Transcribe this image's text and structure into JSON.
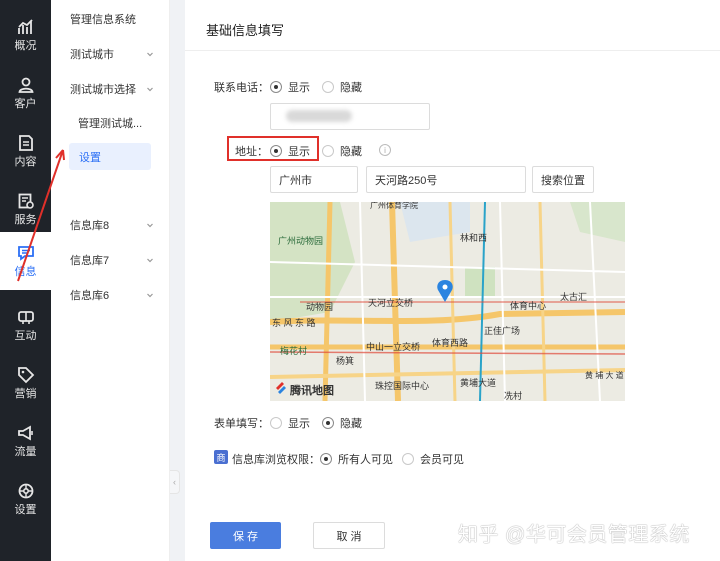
{
  "rail": {
    "items": [
      {
        "label": "概况",
        "icon": "bar-chart-icon"
      },
      {
        "label": "客户",
        "icon": "user-icon"
      },
      {
        "label": "内容",
        "icon": "document-icon"
      },
      {
        "label": "服务",
        "icon": "service-icon"
      },
      {
        "label": "信息",
        "icon": "message-icon"
      },
      {
        "label": "互动",
        "icon": "interaction-icon"
      },
      {
        "label": "营销",
        "icon": "tag-icon"
      },
      {
        "label": "流量",
        "icon": "megaphone-icon"
      },
      {
        "label": "设置",
        "icon": "settings-icon"
      }
    ],
    "active_index": 4
  },
  "submenu": {
    "items": [
      {
        "label": "管理信息系统",
        "has_chevron": false
      },
      {
        "label": "测试城市",
        "has_chevron": true
      },
      {
        "label": "测试城市选择",
        "has_chevron": true
      },
      {
        "label": "管理测试城...",
        "has_chevron": false
      },
      {
        "label": "设置",
        "has_chevron": false
      },
      {
        "label": "信息库8",
        "has_chevron": true
      },
      {
        "label": "信息库7",
        "has_chevron": true
      },
      {
        "label": "信息库6",
        "has_chevron": true
      }
    ],
    "active_label": "设置"
  },
  "form": {
    "title": "基础信息填写",
    "phone": {
      "label": "联系电话：",
      "show": "显示",
      "hide": "隐藏",
      "selected": "显示"
    },
    "address": {
      "label": "地址：",
      "show": "显示",
      "hide": "隐藏",
      "selected": "显示",
      "info": "i",
      "city": "广州市",
      "street": "天河路250号",
      "search_button": "搜索位置"
    },
    "form_fill": {
      "label": "表单填写：",
      "show": "显示",
      "hide": "隐藏",
      "selected": "隐藏"
    },
    "permission": {
      "icon_text": "商",
      "label": "信息库浏览权限：",
      "all": "所有人可见",
      "members": "会员可见",
      "selected": "所有人可见"
    },
    "save": "保 存",
    "cancel": "取 消"
  },
  "map": {
    "labels": {
      "top": "广州体育学院",
      "zoo": "广州动物园",
      "linhexi": "林和西",
      "zoo_station": "动物园",
      "tianhe": "天河立交桥",
      "tiyuzhongxin": "体育中心",
      "taiguhui": "太古汇",
      "dongfeng": "东 风 东 路",
      "zhengjia": "正佳广场",
      "meihuacun": "梅花村",
      "zhongshan": "中山一立交桥",
      "tiyuxilu": "体育西路",
      "yangji": "杨箕",
      "huangpu": "黄 埔 大 道",
      "zhujiang": "珠控国际中心",
      "huangpu_station": "黄埔大道",
      "xiancun": "冼村",
      "brand": "腾讯地图"
    }
  },
  "watermark": "知乎 @华可会员管理系统",
  "colors": {
    "accent": "#2b6ff5",
    "primary_button": "#4a7ddf",
    "highlight_box": "#e0302a",
    "rail_bg": "#1f2329"
  }
}
